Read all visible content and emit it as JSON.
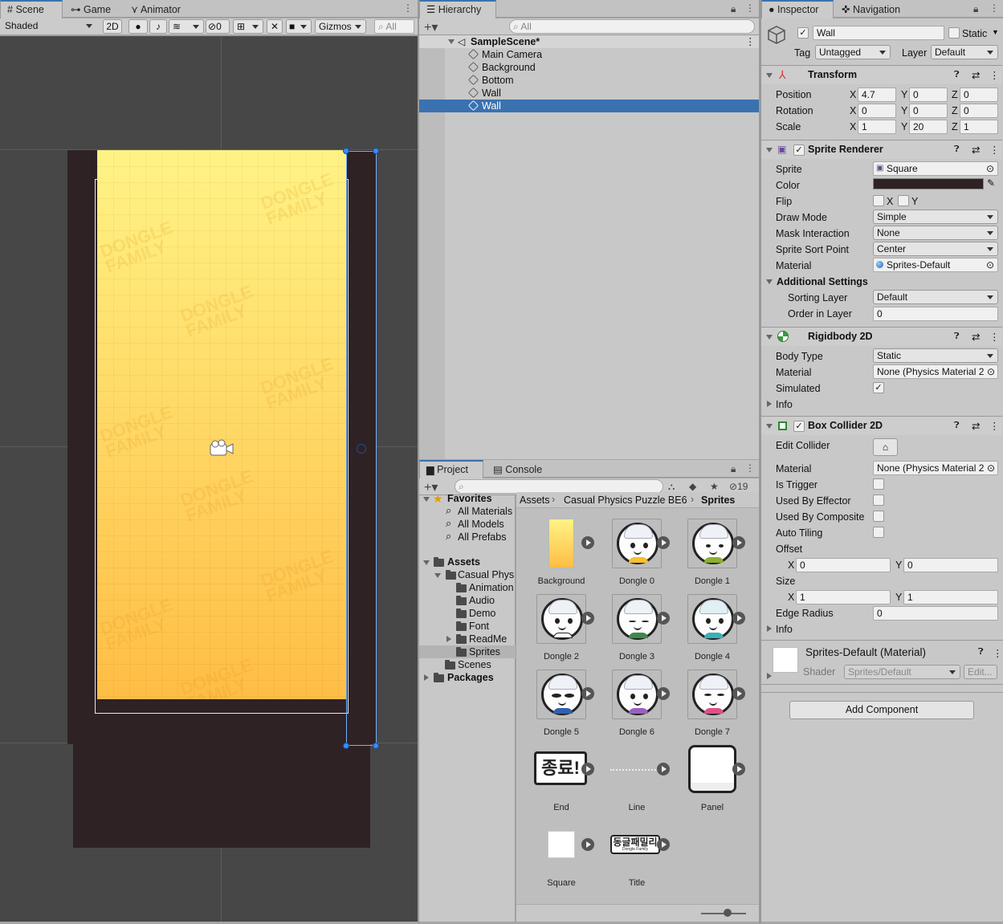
{
  "scene_panel": {
    "tabs": [
      {
        "label": "Scene",
        "icon": "grid-icon"
      },
      {
        "label": "Game",
        "icon": "gamepad-icon"
      },
      {
        "label": "Animator",
        "icon": "animator-icon"
      }
    ],
    "shading_mode": "Shaded",
    "mode_2d": "2D",
    "hidden_count": "0",
    "gizmos_label": "Gizmos",
    "search_placeholder": "All",
    "watermark": "DONGLE FAMILY"
  },
  "hierarchy": {
    "tab_label": "Hierarchy",
    "search_placeholder": "All",
    "scene_name": "SampleScene*",
    "items": [
      {
        "label": "Main Camera"
      },
      {
        "label": "Background"
      },
      {
        "label": "Bottom"
      },
      {
        "label": "Wall"
      },
      {
        "label": "Wall",
        "selected": true
      }
    ]
  },
  "project": {
    "tabs": [
      "Project",
      "Console"
    ],
    "hidden_count": "19",
    "favorites": {
      "label": "Favorites",
      "items": [
        "All Materials",
        "All Models",
        "All Prefabs"
      ]
    },
    "assets_label": "Assets",
    "tree": [
      "Casual Phys",
      "Animation",
      "Audio",
      "Demo",
      "Font",
      "ReadMe",
      "Sprites",
      "Scenes"
    ],
    "packages_label": "Packages",
    "breadcrumb": [
      "Assets",
      "Casual Physics Puzzle BE6",
      "Sprites"
    ],
    "assets": [
      "Background",
      "Dongle 0",
      "Dongle 1",
      "Dongle 2",
      "Dongle 3",
      "Dongle 4",
      "Dongle 5",
      "Dongle 6",
      "Dongle 7",
      "End",
      "Line",
      "Panel",
      "Square",
      "Title"
    ],
    "end_text": "종료!",
    "title_text": "동글패밀리",
    "title_sub": "Dongle Family"
  },
  "inspector": {
    "tabs": [
      "Inspector",
      "Navigation"
    ],
    "object_name": "Wall",
    "static_label": "Static",
    "tag_label": "Tag",
    "tag_value": "Untagged",
    "layer_label": "Layer",
    "layer_value": "Default",
    "transform": {
      "title": "Transform",
      "position": {
        "label": "Position",
        "x": "4.7",
        "y": "0",
        "z": "0"
      },
      "rotation": {
        "label": "Rotation",
        "x": "0",
        "y": "0",
        "z": "0"
      },
      "scale": {
        "label": "Scale",
        "x": "1",
        "y": "20",
        "z": "1"
      }
    },
    "sprite_renderer": {
      "title": "Sprite Renderer",
      "sprite_label": "Sprite",
      "sprite_value": "Square",
      "color_label": "Color",
      "color_value": "#2f2225",
      "flip_label": "Flip",
      "flip_x": "X",
      "flip_y": "Y",
      "draw_mode_label": "Draw Mode",
      "draw_mode_value": "Simple",
      "mask_label": "Mask Interaction",
      "mask_value": "None",
      "sort_point_label": "Sprite Sort Point",
      "sort_point_value": "Center",
      "material_label": "Material",
      "material_value": "Sprites-Default",
      "additional_label": "Additional Settings",
      "sorting_layer_label": "Sorting Layer",
      "sorting_layer_value": "Default",
      "order_label": "Order in Layer",
      "order_value": "0"
    },
    "rigidbody": {
      "title": "Rigidbody 2D",
      "body_type_label": "Body Type",
      "body_type_value": "Static",
      "material_label": "Material",
      "material_value": "None (Physics Material 2",
      "simulated_label": "Simulated",
      "info_label": "Info"
    },
    "box_collider": {
      "title": "Box Collider 2D",
      "edit_label": "Edit Collider",
      "material_label": "Material",
      "material_value": "None (Physics Material 2",
      "trigger_label": "Is Trigger",
      "effector_label": "Used By Effector",
      "composite_label": "Used By Composite",
      "tiling_label": "Auto Tiling",
      "offset_label": "Offset",
      "offset_x": "0",
      "offset_y": "0",
      "size_label": "Size",
      "size_x": "1",
      "size_y": "1",
      "edge_label": "Edge Radius",
      "edge_value": "0",
      "info_label": "Info",
      "x_label": "X",
      "y_label": "Y"
    },
    "material_block": {
      "title": "Sprites-Default (Material)",
      "shader_label": "Shader",
      "shader_value": "Sprites/Default",
      "edit_label": "Edit..."
    },
    "add_component": "Add Component",
    "axis": {
      "x": "X",
      "y": "Y",
      "z": "Z"
    }
  },
  "colors": {
    "accent": "#3a72b0",
    "wall": "#2f2225",
    "bg_top": "#fff385",
    "bg_bottom": "#ffbd45",
    "scene_bg": "#474747"
  }
}
